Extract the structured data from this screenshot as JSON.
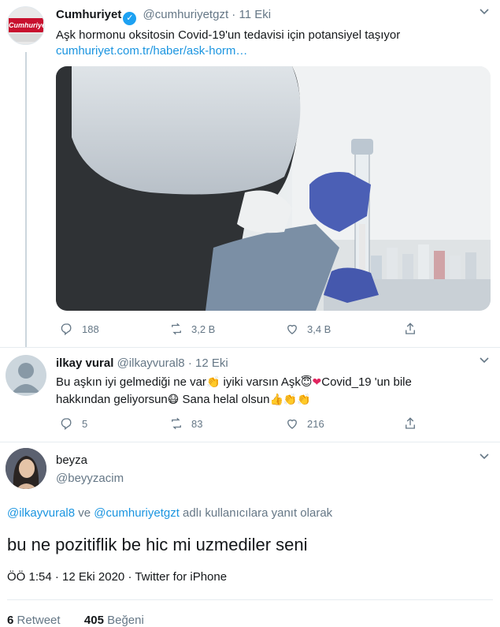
{
  "tweet1": {
    "display_name": "Cumhuriyet",
    "handle": "@cumhuriyetgzt",
    "separator": "·",
    "date": "11 Eki",
    "avatar_logo": "Cumhuriyet",
    "text": "Aşk hormonu oksitosin Covid-19'un tedavisi için potansiyel taşıyor",
    "link": "cumhuriyet.com.tr/haber/ask-horm…",
    "replies": "188",
    "retweets": "3,2 B",
    "likes": "3,4 B"
  },
  "tweet2": {
    "display_name": "ilkay vural",
    "handle": "@ilkayvural8",
    "separator": "·",
    "date": "12 Eki",
    "text_part1": "Bu aşkın iyi gelmediği ne var",
    "text_part2": " iyiki varsın Aşk",
    "text_part3": "Covid_19 'un bile",
    "text_part4": "hakkından geliyorsun",
    "text_part5": " Sana helal olsun",
    "emoji_wave": "👏",
    "emoji_halo": "😇",
    "emoji_heart": "❤",
    "emoji_mask": "😷",
    "emoji_thumb": "👍",
    "replies": "5",
    "retweets": "83",
    "likes": "216"
  },
  "tweet3": {
    "display_name": "beyza",
    "handle": "@beyyzacim",
    "reply_to_user1": "@ilkayvural8",
    "reply_to_and": " ve ",
    "reply_to_user2": "@cumhuriyetgzt",
    "reply_to_suffix": " adlı kullanıcılara yanıt olarak",
    "text": "bu ne pozitiflik be hic mi uzmediler seni",
    "time": "ÖÖ 1:54",
    "date": "12 Eki 2020",
    "source": "Twitter for iPhone",
    "retweet_count": "6",
    "retweet_label": "Retweet",
    "like_count": "405",
    "like_label": "Beğeni"
  },
  "icons": [
    "reply-icon",
    "retweet-icon",
    "like-icon",
    "share-icon",
    "verified-icon",
    "chevron-down-icon"
  ],
  "colors": {
    "link": "#1b95e0",
    "muted": "#657786",
    "verified": "#1da1f2",
    "divider": "#e6ecf0"
  }
}
